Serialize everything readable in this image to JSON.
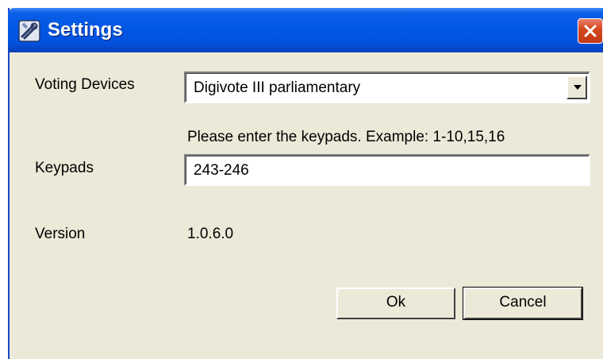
{
  "window": {
    "title": "Settings",
    "icon": "settings-wrench-icon",
    "close_icon": "close-icon"
  },
  "form": {
    "voting_devices_label": "Voting Devices",
    "voting_devices_value": "Digivote III parliamentary",
    "keypads_hint": "Please enter the keypads. Example: 1-10,15,16",
    "keypads_label": "Keypads",
    "keypads_value": "243-246",
    "version_label": "Version",
    "version_value": "1.0.6.0"
  },
  "buttons": {
    "ok_label": "Ok",
    "cancel_label": "Cancel"
  },
  "colors": {
    "titlebar": "#0058e6",
    "dialog_background": "#ece9d8",
    "close_button": "#d64a22"
  }
}
